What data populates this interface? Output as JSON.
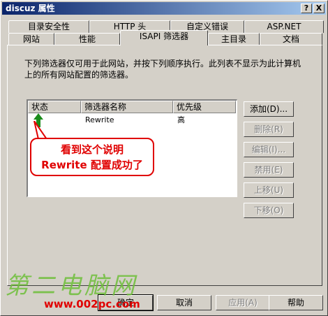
{
  "window": {
    "title": "discuz 属性",
    "help_btn": "?",
    "close_btn": "X"
  },
  "tabs_back": [
    {
      "label": "目录安全性"
    },
    {
      "label": "HTTP 头"
    },
    {
      "label": "自定义错误"
    },
    {
      "label": "ASP.NET"
    }
  ],
  "tabs_front": [
    {
      "label": "网站"
    },
    {
      "label": "性能"
    },
    {
      "label": "ISAPI 筛选器"
    },
    {
      "label": "主目录"
    },
    {
      "label": "文档"
    }
  ],
  "description": "下列筛选器仅可用于此网站，并按下列顺序执行。此列表不显示为此计算机上的所有网站配置的筛选器。",
  "list": {
    "columns": [
      "状态",
      "筛选器名称",
      "优先级"
    ],
    "rows": [
      {
        "name": "Rewrite",
        "priority": "高"
      }
    ]
  },
  "side_buttons": [
    "添加(D)...",
    "删除(R)",
    "编辑(I)...",
    "禁用(E)",
    "上移(U)",
    "下移(O)"
  ],
  "annotation": {
    "line1": "看到这个说明",
    "line2": "Rewrite 配置成功了"
  },
  "bottom_buttons": [
    "确定",
    "取消",
    "应用(A)",
    "帮助"
  ],
  "watermark": {
    "text": "第二电脑网",
    "url": "www.002pc.com"
  },
  "colors": {
    "accent": "#0a246a",
    "annotation": "#e00000",
    "status_arrow": "#1a8c1a",
    "watermark": "#6fbf3a"
  }
}
